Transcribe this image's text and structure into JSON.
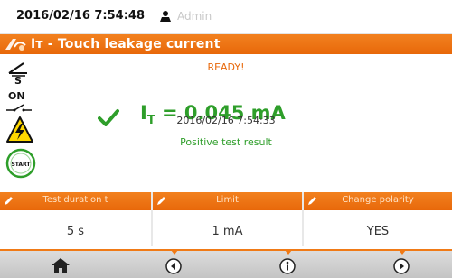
{
  "status_bar": {
    "datetime": "2016/02/16 7:54:48",
    "user": "Admin",
    "user_icon": "user-icon"
  },
  "title_bar": {
    "title": "Iᴛ - Touch leakage current",
    "icon": "measurement-icon"
  },
  "side_panel": {
    "on_label": "ON",
    "start_label": "START"
  },
  "result": {
    "status": "READY!",
    "symbol_main": "I",
    "symbol_sub": "T",
    "value_text": " = 0.045 mA",
    "timestamp": "2016/02/16 7:54:33",
    "verdict": "Positive test result"
  },
  "parameters": [
    {
      "title": "Test duration t",
      "value": "5 s"
    },
    {
      "title": "Limit",
      "value": "1 mA"
    },
    {
      "title": "Change polarity",
      "value": "YES"
    }
  ],
  "nav": [
    {
      "icon": "home-icon"
    },
    {
      "icon": "back-icon"
    },
    {
      "icon": "info-icon"
    },
    {
      "icon": "forward-icon"
    }
  ],
  "colors": {
    "accent": "#e8680a",
    "pass": "#2e9e2a",
    "ready": "#e8680a"
  }
}
